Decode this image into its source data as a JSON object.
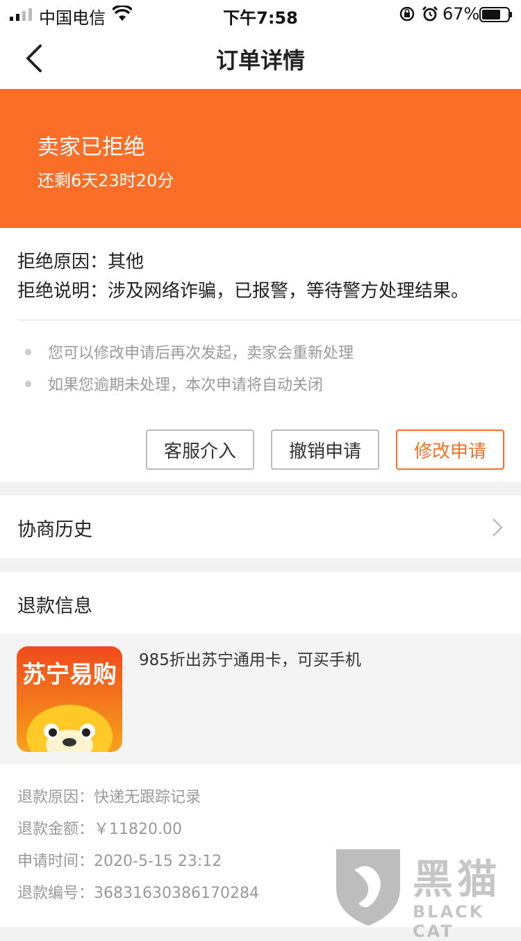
{
  "status_bar": {
    "carrier": "中国电信",
    "time": "下午7:58",
    "battery": "67%",
    "icons": [
      "signal-icon",
      "wifi-icon",
      "orientation-lock-icon",
      "alarm-icon",
      "battery-icon"
    ]
  },
  "nav": {
    "title": "订单详情",
    "back_icon": "back-arrow-icon"
  },
  "banner": {
    "title": "卖家已拒绝",
    "countdown": "还剩6天23时20分",
    "color": "#fb6e28"
  },
  "reject": {
    "reason": "拒绝原因：其他",
    "explain": "拒绝说明：涉及网络诈骗，已报警，等待警方处理结果。"
  },
  "tips": [
    "您可以修改申请后再次发起，卖家会重新处理",
    "如果您逾期未处理，本次申请将自动关闭"
  ],
  "buttons": {
    "service": "客服介入",
    "cancel": "撤销申请",
    "modify": "修改申请"
  },
  "history": {
    "label": "协商历史"
  },
  "refund": {
    "title": "退款信息",
    "product_name": "985折出苏宁通用卡，可买手机",
    "product_logo_text": "苏宁易购",
    "reason_label": "退款原因：",
    "reason_value": "快递无跟踪记录",
    "amount_label": "退款金额：",
    "amount_value": "￥11820.00",
    "time_label": "申请时间：",
    "time_value": "2020-5-15 23:12",
    "id_label": "退款编号：",
    "id_value": "36831630386170284"
  },
  "watermark": {
    "cn": "黑猫",
    "en": "BLACK CAT"
  }
}
